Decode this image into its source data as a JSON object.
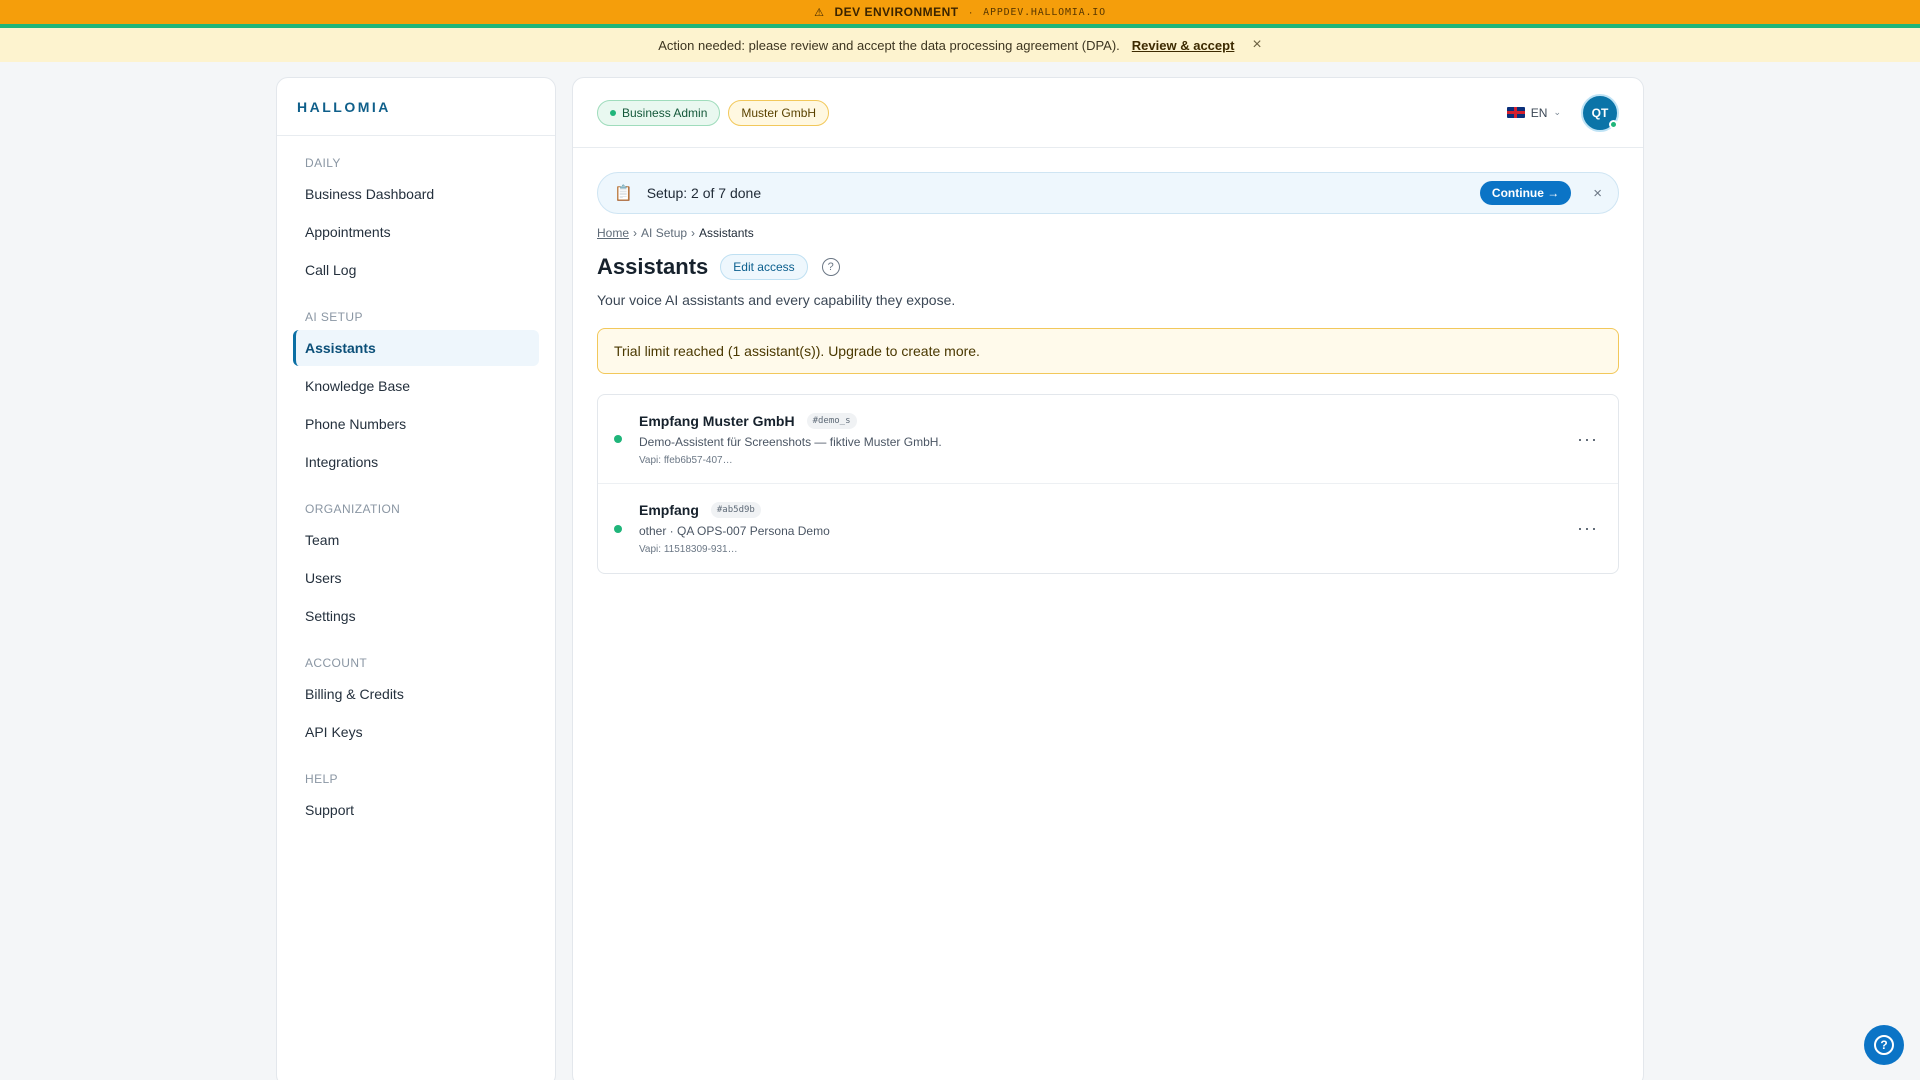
{
  "dev_banner": {
    "icon": "warning-icon",
    "label": "DEV ENVIRONMENT",
    "separator": "·",
    "host": "APPDEV.HALLOMIA.IO"
  },
  "dpa": {
    "message": "Action needed: please review and accept the data processing agreement (DPA).",
    "link": "Review & accept",
    "close": "×"
  },
  "sidebar": {
    "brand": "HALLOMIA",
    "sections": [
      {
        "title": "DAILY",
        "items": [
          "Business Dashboard",
          "Appointments",
          "Call Log"
        ]
      },
      {
        "title": "AI SETUP",
        "items": [
          "Assistants",
          "Knowledge Base",
          "Phone Numbers",
          "Integrations"
        ]
      },
      {
        "title": "ORGANIZATION",
        "items": [
          "Team",
          "Users",
          "Settings"
        ]
      },
      {
        "title": "ACCOUNT",
        "items": [
          "Billing & Credits",
          "API Keys"
        ]
      },
      {
        "title": "HELP",
        "items": [
          "Support"
        ]
      }
    ],
    "active_item": "Assistants"
  },
  "topbar": {
    "role_badge": "Business Admin",
    "org_badge": "Muster GmbH",
    "language": "EN",
    "avatar_initials": "QT"
  },
  "setup": {
    "icon": "clipboard-icon",
    "text": "Setup: 2 of 7 done",
    "continue": "Continue →",
    "close": "×"
  },
  "breadcrumb": {
    "home": "Home",
    "sep": "›",
    "section": "AI Setup",
    "current": "Assistants"
  },
  "page": {
    "title": "Assistants",
    "edit_access": "Edit access",
    "help": "?",
    "subtitle": "Your voice AI assistants and every capability they expose."
  },
  "trial_notice": "Trial limit reached (1 assistant(s)). Upgrade to create more.",
  "assistants": [
    {
      "name": "Empfang Muster GmbH",
      "tag": "#demo_s",
      "description": "Demo-Assistent für Screenshots — fiktive Muster GmbH.",
      "vapi": "Vapi: ffeb6b57-407…",
      "status_color": "#1fb57a"
    },
    {
      "name": "Empfang",
      "tag": "#ab5d9b",
      "description": "other · QA OPS-007 Persona Demo",
      "vapi": "Vapi: 11518309-931…",
      "status_color": "#1fb57a"
    }
  ],
  "more_label": "···",
  "colors": {
    "accent": "#0b74c6",
    "dev_banner": "#f59e0b",
    "success": "#1fb57a",
    "notice": "#fdf3cf"
  }
}
